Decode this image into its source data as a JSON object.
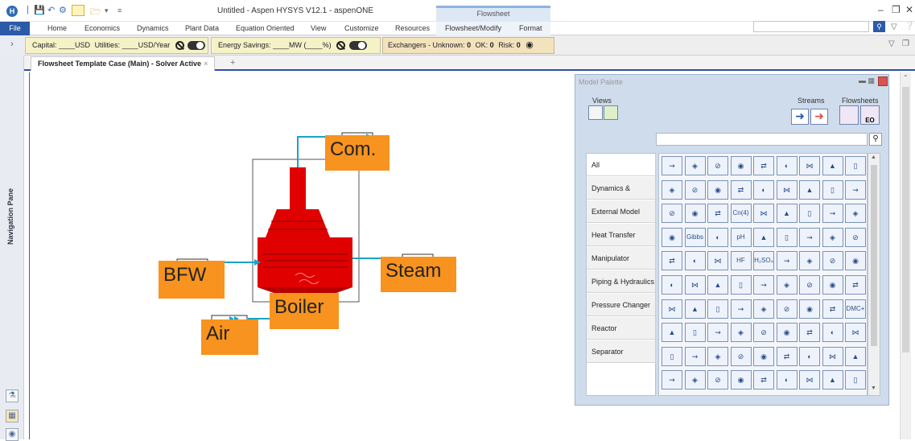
{
  "window": {
    "title": "Untitled - Aspen HYSYS V12.1 - aspenONE",
    "context_group": "Flowsheet",
    "app_icon_letter": "H"
  },
  "ribbon": {
    "file_tab": "File",
    "tabs": [
      "Home",
      "Economics",
      "Dynamics",
      "Plant Data",
      "Equation Oriented",
      "View",
      "Customize",
      "Resources",
      "Flowsheet/Modify",
      "Format"
    ]
  },
  "status_strip": {
    "capital_label": "Capital: ____USD",
    "utilities_label": "Utilities: ____USD/Year",
    "energy_savings_label": "Energy Savings: ____MW  (____%)",
    "exchangers_label": "Exchangers -",
    "unknown_label": "Unknown:",
    "unknown_value": "0",
    "ok_label": "OK:",
    "ok_value": "0",
    "risk_label": "Risk:",
    "risk_value": "0"
  },
  "nav_pane": {
    "label": "Navigation Pane"
  },
  "document_tab": {
    "label": "Flowsheet Template Case (Main) - Solver Active"
  },
  "flowsheet": {
    "unit_label": "Boiler",
    "streams": {
      "bfw": "BFW",
      "steam": "Steam",
      "air": "Air",
      "com": "Com."
    },
    "colors": {
      "label_bg": "#f7931e",
      "boiler": "#e00000",
      "stream": "#1aa3c8"
    }
  },
  "palette": {
    "title": "Model Palette",
    "views_label": "Views",
    "streams_label": "Streams",
    "flowsheets_label": "Flowsheets",
    "categories": [
      "All",
      "Dynamics & Control",
      "External Model",
      "Heat Transfer",
      "Manipulator",
      "Piping & Hydraulics",
      "Pressure Changer",
      "Reactor",
      "Separator"
    ],
    "icon_texts": {
      "cn": "Cn(4)",
      "gibbs": "Gibbs",
      "ph": "pH",
      "hf": "HF",
      "h2so4": "H₂SO₄",
      "dmc": "DMC+"
    }
  }
}
